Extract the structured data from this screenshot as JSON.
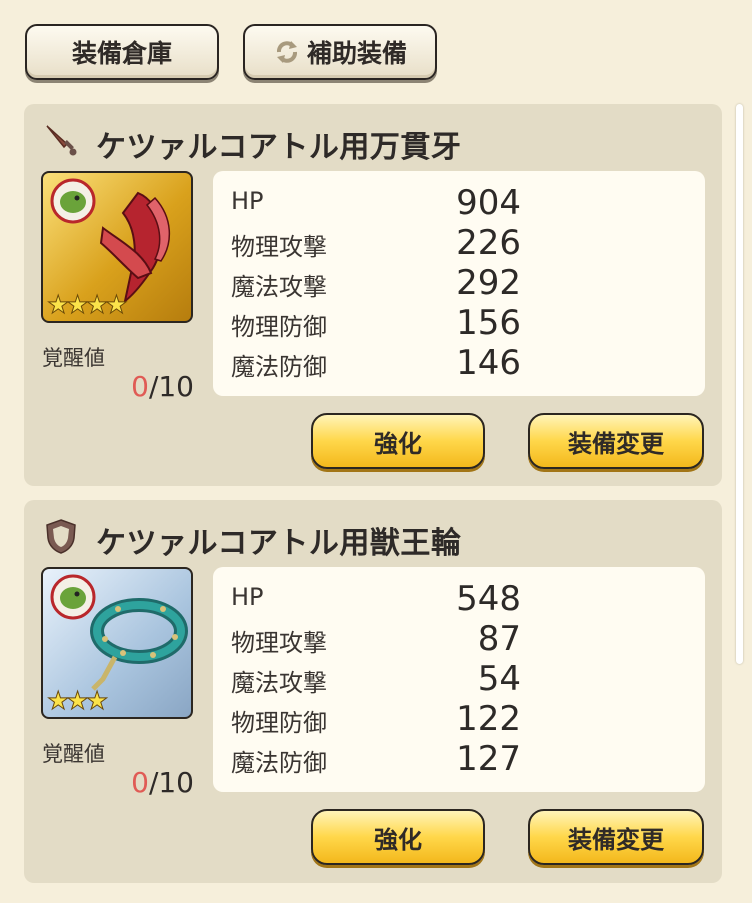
{
  "top_buttons": {
    "storage_label": "装備倉庫",
    "support_label": "補助装備",
    "support_icon": "swap-arrows-icon"
  },
  "equipment": [
    {
      "category_icon": "dagger-icon",
      "name": "ケツァルコアトル用万貫牙",
      "rarity_stars": 4,
      "frame": "gold",
      "stars_text": "★★★★",
      "awakening_label": "覚醒値",
      "awakening_current": "0",
      "awakening_max": "/10",
      "stats": [
        {
          "name": "HP",
          "value": "904"
        },
        {
          "name": "物理攻撃",
          "value": "226"
        },
        {
          "name": "魔法攻撃",
          "value": "292"
        },
        {
          "name": "物理防御",
          "value": "156"
        },
        {
          "name": "魔法防御",
          "value": "146"
        }
      ],
      "enhance_label": "強化",
      "change_label": "装備変更"
    },
    {
      "category_icon": "shield-icon",
      "name": "ケツァルコアトル用獣王輪",
      "rarity_stars": 3,
      "frame": "silver",
      "stars_text": "★★★",
      "awakening_label": "覚醒値",
      "awakening_current": "0",
      "awakening_max": "/10",
      "stats": [
        {
          "name": "HP",
          "value": "548"
        },
        {
          "name": "物理攻撃",
          "value": "87"
        },
        {
          "name": "魔法攻撃",
          "value": "54"
        },
        {
          "name": "物理防御",
          "value": "122"
        },
        {
          "name": "魔法防御",
          "value": "127"
        }
      ],
      "enhance_label": "強化",
      "change_label": "装備変更"
    }
  ],
  "colors": {
    "background": "#f6efdb",
    "panel": "#e3dcc6",
    "button_yellow": "#ffd74a",
    "awakening_zero": "#e05b55"
  }
}
